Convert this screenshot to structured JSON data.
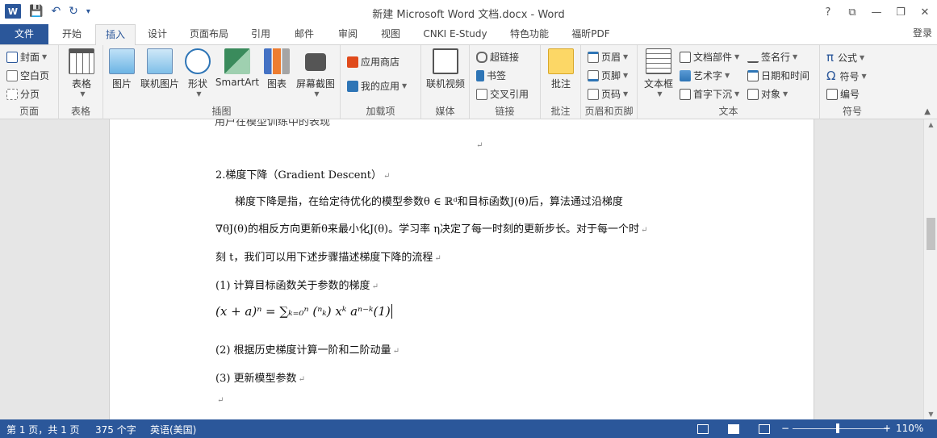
{
  "window": {
    "title": "新建 Microsoft Word 文档.docx - Word",
    "help": "?",
    "ribbon_display": "⧉",
    "minimize": "—",
    "restore": "❐",
    "close": "✕"
  },
  "qat": {
    "logo": "W",
    "save": "💾",
    "undo": "↶",
    "redo": "↻",
    "customize": "▾"
  },
  "tabs": {
    "file": "文件",
    "home": "开始",
    "insert": "插入",
    "design": "设计",
    "layout": "页面布局",
    "references": "引用",
    "mailings": "邮件",
    "review": "审阅",
    "view": "视图",
    "cnki": "CNKI E-Study",
    "special": "特色功能",
    "foxit": "福昕PDF"
  },
  "login": "登录",
  "ribbon": {
    "pages": {
      "label": "页面",
      "cover": "封面",
      "blank": "空白页",
      "break": "分页"
    },
    "tables": {
      "label": "表格",
      "table": "表格"
    },
    "illustrations": {
      "label": "插图",
      "picture": "图片",
      "online_picture": "联机图片",
      "shapes": "形状",
      "smartart": "SmartArt",
      "chart": "图表",
      "screenshot": "屏幕截图"
    },
    "addins": {
      "label": "加载项",
      "store": "应用商店",
      "my_apps": "我的应用"
    },
    "media": {
      "label": "媒体",
      "online_video": "联机视频"
    },
    "links": {
      "label": "链接",
      "hyperlink": "超链接",
      "bookmark": "书签",
      "crossref": "交叉引用"
    },
    "comments": {
      "label": "批注",
      "comment": "批注"
    },
    "headerfooter": {
      "label": "页眉和页脚",
      "header": "页眉",
      "footer": "页脚",
      "page_number": "页码"
    },
    "text": {
      "label": "文本",
      "textbox": "文本框",
      "quickparts": "文档部件",
      "wordart": "艺术字",
      "dropcap": "首字下沉",
      "signature": "签名行",
      "datetime": "日期和时间",
      "object": "对象"
    },
    "symbols": {
      "label": "符号",
      "equation": "公式",
      "symbol": "符号",
      "numbering": "编号"
    }
  },
  "document": {
    "top_partial": "用户在模型训练中的表现",
    "heading": "2.梯度下降（Gradient Descent）",
    "para1": "梯度下降是指，在给定待优化的模型参数θ ∈ ℝᵈ和目标函数J(θ)后，算法通过沿梯度",
    "para2": "∇θJ(θ)的相反方向更新θ来最小化J(θ)。学习率 η决定了每一时刻的更新步长。对于每一个时",
    "para3": "刻 t，我们可以用下述步骤描述梯度下降的流程",
    "step1": "(1)  计算目标函数关于参数的梯度",
    "formula": "(x + a)ⁿ = ∑ₖ₌₀ⁿ (ⁿₖ) xᵏ aⁿ⁻ᵏ(1)",
    "step2": "(2)  根据历史梯度计算一阶和二阶动量",
    "step3": "(3)  更新模型参数",
    "para_mark": "↵"
  },
  "status": {
    "page": "第 1 页，共 1 页",
    "words": "375 个字",
    "lang": "英语(美国)",
    "minus": "−",
    "plus": "+",
    "zoom": "110%"
  },
  "colors": {
    "accent": "#2b579a"
  }
}
